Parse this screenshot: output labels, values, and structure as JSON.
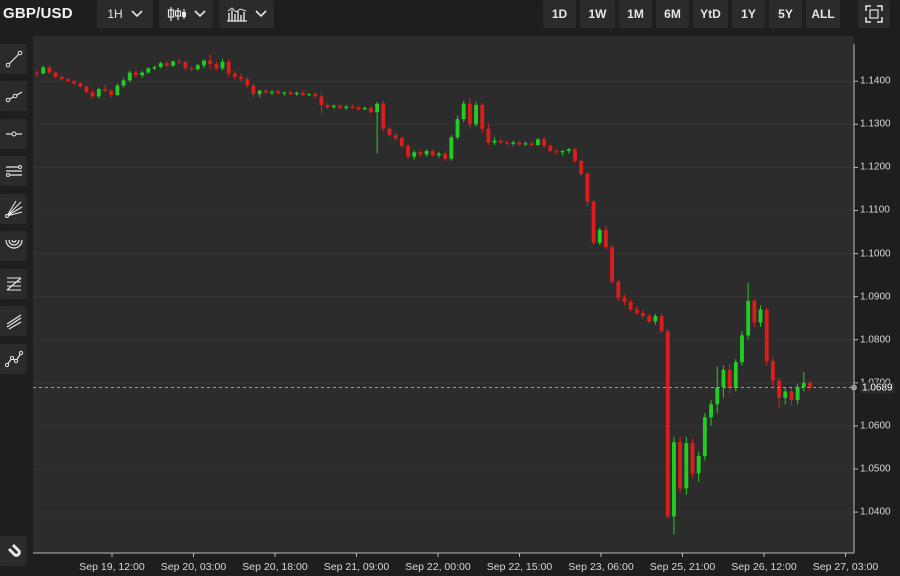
{
  "symbol": "GBP/USD",
  "toolbar": {
    "interval": "1H",
    "chart_style_icon": "candlestick-icon",
    "indicator_icon": "bar-chart-icon",
    "ranges": [
      "1D",
      "1W",
      "1M",
      "6M",
      "YtD",
      "1Y",
      "5Y",
      "ALL"
    ],
    "fullscreen_icon": "fullscreen-icon"
  },
  "left_tools": [
    "trend-line-icon",
    "ray-icon",
    "horizontal-line-icon",
    "parallel-channel-icon",
    "fan-icon",
    "arc-icon",
    "fib-retracement-icon",
    "pitchfork-icon",
    "path-icon",
    "magnet-icon"
  ],
  "last_price": "1.0689",
  "colors": {
    "up": "#22cc22",
    "down": "#dd1c1c",
    "plot_bg": "#2c2c2c",
    "grid": "#3a3a3a"
  },
  "chart_data": {
    "type": "candlestick",
    "title": "",
    "ylim": [
      1.0305,
      1.1505
    ],
    "yticks": [
      "1.1400",
      "1.1300",
      "1.1200",
      "1.1100",
      "1.1000",
      "1.0900",
      "1.0800",
      "1.0700",
      "1.0600",
      "1.0500",
      "1.0400"
    ],
    "xticks": [
      "Sep 19, 12:00",
      "Sep 20, 03:00",
      "Sep 20, 18:00",
      "Sep 21, 09:00",
      "Sep 22, 00:00",
      "Sep 22, 15:00",
      "Sep 23, 06:00",
      "Sep 25, 21:00",
      "Sep 26, 12:00",
      "Sep 27, 03:00"
    ],
    "last": 1.0689,
    "ohlc": [
      [
        1.142,
        1.1425,
        1.141,
        1.1418
      ],
      [
        1.1418,
        1.1436,
        1.1416,
        1.1432
      ],
      [
        1.1432,
        1.1435,
        1.1418,
        1.142
      ],
      [
        1.142,
        1.1422,
        1.1408,
        1.141
      ],
      [
        1.141,
        1.1412,
        1.1402,
        1.1405
      ],
      [
        1.1405,
        1.1408,
        1.1398,
        1.14
      ],
      [
        1.14,
        1.1403,
        1.1392,
        1.1395
      ],
      [
        1.1395,
        1.1398,
        1.1385,
        1.1388
      ],
      [
        1.1388,
        1.139,
        1.1372,
        1.1375
      ],
      [
        1.1375,
        1.138,
        1.136,
        1.1365
      ],
      [
        1.1365,
        1.1385,
        1.136,
        1.1382
      ],
      [
        1.1382,
        1.1392,
        1.1375,
        1.1378
      ],
      [
        1.1378,
        1.1382,
        1.1362,
        1.1368
      ],
      [
        1.1368,
        1.1395,
        1.1365,
        1.139
      ],
      [
        1.139,
        1.1408,
        1.1385,
        1.1402
      ],
      [
        1.1402,
        1.1425,
        1.1398,
        1.142
      ],
      [
        1.142,
        1.1426,
        1.141,
        1.1414
      ],
      [
        1.1414,
        1.1424,
        1.1408,
        1.142
      ],
      [
        1.142,
        1.1432,
        1.1418,
        1.143
      ],
      [
        1.143,
        1.1436,
        1.1426,
        1.1433
      ],
      [
        1.1433,
        1.1445,
        1.143,
        1.1442
      ],
      [
        1.1442,
        1.1446,
        1.1434,
        1.1436
      ],
      [
        1.1436,
        1.1448,
        1.1433,
        1.1446
      ],
      [
        1.1446,
        1.1452,
        1.144,
        1.1444
      ],
      [
        1.1444,
        1.1448,
        1.1425,
        1.143
      ],
      [
        1.143,
        1.1434,
        1.1424,
        1.1428
      ],
      [
        1.1428,
        1.144,
        1.1425,
        1.1437
      ],
      [
        1.1437,
        1.145,
        1.143,
        1.1448
      ],
      [
        1.1448,
        1.1462,
        1.1428,
        1.144
      ],
      [
        1.144,
        1.1445,
        1.1425,
        1.143
      ],
      [
        1.143,
        1.1452,
        1.1425,
        1.1445
      ],
      [
        1.1445,
        1.145,
        1.141,
        1.1418
      ],
      [
        1.1418,
        1.1425,
        1.1405,
        1.141
      ],
      [
        1.141,
        1.1418,
        1.1398,
        1.1405
      ],
      [
        1.1405,
        1.141,
        1.1385,
        1.139
      ],
      [
        1.139,
        1.1395,
        1.1362,
        1.137
      ],
      [
        1.137,
        1.138,
        1.1362,
        1.1378
      ],
      [
        1.1378,
        1.1382,
        1.137,
        1.1374
      ],
      [
        1.1374,
        1.1378,
        1.1368,
        1.1376
      ],
      [
        1.1376,
        1.138,
        1.137,
        1.1372
      ],
      [
        1.1372,
        1.1376,
        1.1366,
        1.1374
      ],
      [
        1.1374,
        1.1378,
        1.1368,
        1.137
      ],
      [
        1.137,
        1.1376,
        1.1366,
        1.1373
      ],
      [
        1.1373,
        1.1378,
        1.1365,
        1.1368
      ],
      [
        1.1368,
        1.1372,
        1.1365,
        1.137
      ],
      [
        1.137,
        1.1374,
        1.136,
        1.1365
      ],
      [
        1.1365,
        1.1372,
        1.1325,
        1.1345
      ],
      [
        1.1345,
        1.135,
        1.1335,
        1.134
      ],
      [
        1.134,
        1.1346,
        1.1336,
        1.1343
      ],
      [
        1.1343,
        1.1347,
        1.1335,
        1.1338
      ],
      [
        1.1338,
        1.1345,
        1.1333,
        1.1341
      ],
      [
        1.1341,
        1.1346,
        1.1336,
        1.1339
      ],
      [
        1.1339,
        1.1343,
        1.1332,
        1.1335
      ],
      [
        1.1335,
        1.1341,
        1.1333,
        1.1338
      ],
      [
        1.1338,
        1.1342,
        1.1325,
        1.1328
      ],
      [
        1.1328,
        1.1352,
        1.1232,
        1.1348
      ],
      [
        1.1348,
        1.1355,
        1.1285,
        1.129
      ],
      [
        1.129,
        1.1295,
        1.127,
        1.1275
      ],
      [
        1.1275,
        1.128,
        1.1262,
        1.1268
      ],
      [
        1.1268,
        1.1272,
        1.1245,
        1.125
      ],
      [
        1.125,
        1.1255,
        1.122,
        1.1225
      ],
      [
        1.1225,
        1.124,
        1.1218,
        1.1235
      ],
      [
        1.1235,
        1.124,
        1.1225,
        1.123
      ],
      [
        1.123,
        1.1242,
        1.1225,
        1.1238
      ],
      [
        1.1238,
        1.1242,
        1.1225,
        1.1228
      ],
      [
        1.1228,
        1.1236,
        1.1222,
        1.1232
      ],
      [
        1.1232,
        1.1238,
        1.1215,
        1.122
      ],
      [
        1.122,
        1.1275,
        1.1215,
        1.127
      ],
      [
        1.127,
        1.132,
        1.1265,
        1.1312
      ],
      [
        1.1312,
        1.1355,
        1.1305,
        1.1348
      ],
      [
        1.1348,
        1.1362,
        1.129,
        1.13
      ],
      [
        1.13,
        1.1352,
        1.1295,
        1.1345
      ],
      [
        1.1345,
        1.135,
        1.128,
        1.129
      ],
      [
        1.129,
        1.1302,
        1.1252,
        1.1258
      ],
      [
        1.1258,
        1.127,
        1.1252,
        1.1262
      ],
      [
        1.1262,
        1.1266,
        1.1254,
        1.1258
      ],
      [
        1.1258,
        1.1262,
        1.125,
        1.1255
      ],
      [
        1.1255,
        1.1262,
        1.125,
        1.1258
      ],
      [
        1.1258,
        1.1262,
        1.125,
        1.1253
      ],
      [
        1.1253,
        1.126,
        1.125,
        1.1256
      ],
      [
        1.1256,
        1.126,
        1.125,
        1.1252
      ],
      [
        1.1252,
        1.1268,
        1.125,
        1.1265
      ],
      [
        1.1265,
        1.127,
        1.1245,
        1.125
      ],
      [
        1.125,
        1.1254,
        1.1235,
        1.1238
      ],
      [
        1.1238,
        1.1242,
        1.123,
        1.1235
      ],
      [
        1.1235,
        1.124,
        1.1228,
        1.1238
      ],
      [
        1.1238,
        1.1245,
        1.1232,
        1.1242
      ],
      [
        1.1242,
        1.1246,
        1.121,
        1.1215
      ],
      [
        1.1215,
        1.1218,
        1.118,
        1.1185
      ],
      [
        1.1185,
        1.119,
        1.111,
        1.112
      ],
      [
        1.112,
        1.1125,
        1.102,
        1.1025
      ],
      [
        1.1025,
        1.106,
        1.102,
        1.1055
      ],
      [
        1.1055,
        1.1065,
        1.1008,
        1.1015
      ],
      [
        1.1015,
        1.102,
        1.093,
        1.0935
      ],
      [
        1.0935,
        1.094,
        1.089,
        1.0898
      ],
      [
        1.0898,
        1.0905,
        1.088,
        1.0888
      ],
      [
        1.0888,
        1.0895,
        1.0865,
        1.087
      ],
      [
        1.087,
        1.0878,
        1.0858,
        1.0862
      ],
      [
        1.0862,
        1.087,
        1.085,
        1.0855
      ],
      [
        1.0855,
        1.086,
        1.0838,
        1.0842
      ],
      [
        1.0842,
        1.086,
        1.0835,
        1.0855
      ],
      [
        1.0855,
        1.086,
        1.0815,
        1.082
      ],
      [
        1.082,
        1.0825,
        1.0385,
        1.039
      ],
      [
        1.039,
        1.0575,
        1.0348,
        1.0562
      ],
      [
        1.0562,
        1.0575,
        1.0445,
        1.0455
      ],
      [
        1.0455,
        1.0575,
        1.044,
        1.056
      ],
      [
        1.056,
        1.057,
        1.048,
        1.049
      ],
      [
        1.049,
        1.054,
        1.047,
        1.053
      ],
      [
        1.053,
        1.063,
        1.052,
        1.062
      ],
      [
        1.062,
        1.066,
        1.06,
        1.065
      ],
      [
        1.065,
        1.0738,
        1.063,
        1.069
      ],
      [
        1.069,
        1.074,
        1.0665,
        1.073
      ],
      [
        1.073,
        1.0745,
        1.0675,
        1.0688
      ],
      [
        1.0688,
        1.0755,
        1.068,
        1.0748
      ],
      [
        1.0748,
        1.082,
        1.074,
        1.081
      ],
      [
        1.081,
        1.0932,
        1.08,
        1.089
      ],
      [
        1.089,
        1.0895,
        1.083,
        1.084
      ],
      [
        1.084,
        1.088,
        1.083,
        1.087
      ],
      [
        1.087,
        1.0875,
        1.074,
        1.075
      ],
      [
        1.075,
        1.076,
        1.069,
        1.0705
      ],
      [
        1.0705,
        1.0712,
        1.064,
        1.0665
      ],
      [
        1.0665,
        1.069,
        1.065,
        1.068
      ],
      [
        1.068,
        1.069,
        1.0648,
        1.066
      ],
      [
        1.066,
        1.0698,
        1.065,
        1.069
      ],
      [
        1.069,
        1.0725,
        1.068,
        1.07
      ],
      [
        1.07,
        1.0705,
        1.0682,
        1.0689
      ]
    ]
  }
}
